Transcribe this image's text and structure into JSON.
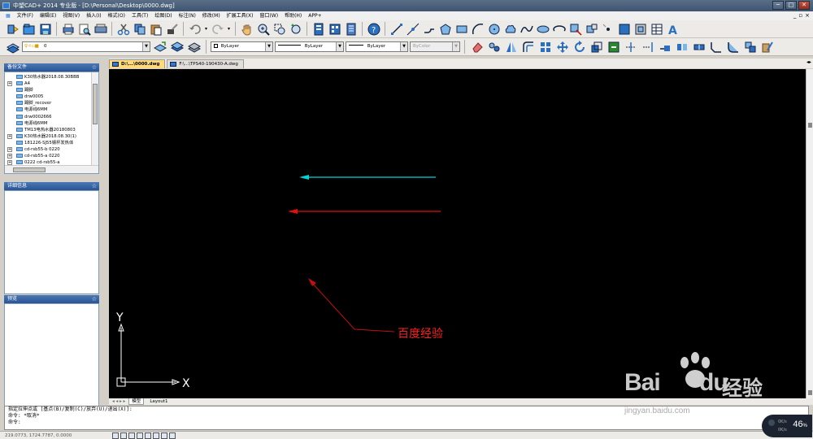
{
  "app": {
    "title": "中望CAD+ 2014 专业版 - [D:\\Personal\\Desktop\\0000.dwg]",
    "window_buttons": [
      "─",
      "□",
      "✕"
    ],
    "mdi_buttons": [
      "_",
      "▫",
      "×"
    ]
  },
  "menu": [
    "文件(F)",
    "编辑(E)",
    "视图(V)",
    "插入(I)",
    "格式(O)",
    "工具(T)",
    "绘图(D)",
    "标注(N)",
    "修改(M)",
    "扩展工具(X)",
    "窗口(W)",
    "帮助(H)",
    "APP+"
  ],
  "toolbar2": {
    "layer_value": "0",
    "color_value": "ByLayer",
    "linetype_value": "ByLayer",
    "lineweight_value": "ByLayer",
    "plotstyle_value": "ByColor"
  },
  "panels": {
    "backup_title": "备份文件",
    "details_title": "详细信息",
    "preview_title": "预览",
    "tree_items": [
      {
        "label": "K30热水器2018.08.30BBB",
        "expand": false
      },
      {
        "label": "A4",
        "expand": true
      },
      {
        "label": "踢脚",
        "expand": false
      },
      {
        "label": "drw0005",
        "expand": false
      },
      {
        "label": "踢脚_recover",
        "expand": false
      },
      {
        "label": "电源线6MM",
        "expand": false
      },
      {
        "label": "drw0002666",
        "expand": false
      },
      {
        "label": "电源线6MM",
        "expand": false
      },
      {
        "label": "TM13电热水器20180803",
        "expand": false
      },
      {
        "label": "K30热水器2018.08.30(1)",
        "expand": true
      },
      {
        "label": "181226-SJ55钢杯发热体",
        "expand": false
      },
      {
        "label": "cd-rsb55-b 0220",
        "expand": true
      },
      {
        "label": "cd-rsb55-a 0220",
        "expand": true
      },
      {
        "label": "0222 cd-rsb55-a",
        "expand": true
      }
    ]
  },
  "tabs": [
    {
      "label": "D:\\...\\0000.dwg",
      "active": true
    },
    {
      "label": "F:\\...\\TPS40-190430-A.dwg",
      "active": false
    }
  ],
  "canvas": {
    "annotation": "百度经验",
    "ucs_x": "X",
    "ucs_y": "Y",
    "colors": {
      "cyan_line": "#00d4d4",
      "red_line": "#e01010",
      "annotation": "#ff2020"
    }
  },
  "layout_tabs": [
    "模型",
    "Layout1"
  ],
  "command": {
    "line1": "指定拉伸点或 [基点(B)/复制(C)/放弃(U)/退出(X)]:",
    "line2": "命令: *取消*",
    "line3": "命令:"
  },
  "status": {
    "coords": "219.0773, 1724.7787, 0.0000"
  },
  "watermark": {
    "brand": "Bai",
    "suffix": "经验",
    "url": "jingyan.baidu.com"
  },
  "perf": {
    "value": "46",
    "unit": "%",
    "up": "0K/s",
    "down": "0K/s"
  }
}
